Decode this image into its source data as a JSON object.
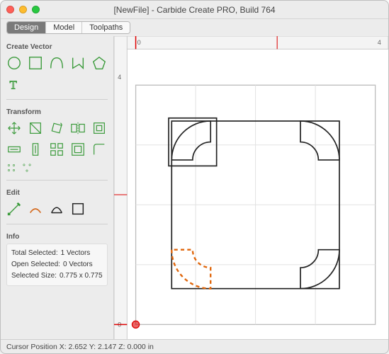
{
  "title": "[NewFile] - Carbide Create PRO, Build 764",
  "tabs": {
    "design": "Design",
    "model": "Model",
    "toolpaths": "Toolpaths",
    "active": "design"
  },
  "sections": {
    "create_vector": "Create Vector",
    "transform": "Transform",
    "edit": "Edit",
    "info": "Info"
  },
  "create_icons": [
    "circle",
    "rect",
    "curve",
    "polyline",
    "polygon",
    "text"
  ],
  "transform_icons": [
    "move",
    "resize",
    "rotate",
    "mirror",
    "align",
    "scale-width",
    "scale-height",
    "offset",
    "corner"
  ],
  "group_icons": [
    "group",
    "ungroup"
  ],
  "edit_icons": [
    "node-edit",
    "trim",
    "boolean",
    "crop"
  ],
  "info": {
    "total_selected_label": "Total Selected:",
    "total_selected_value": "1 Vectors",
    "open_selected_label": "Open Selected:",
    "open_selected_value": "0 Vectors",
    "selected_size_label": "Selected Size:",
    "selected_size_value": "0.775 x 0.775"
  },
  "ruler": {
    "top_marks": [
      "0",
      "4"
    ],
    "left_marks": [
      "0",
      "4"
    ]
  },
  "status": {
    "prefix": "Cursor Position",
    "x_label": "X:",
    "x": "2.652",
    "y_label": "Y:",
    "y": "2.147",
    "z_label": "Z:",
    "z": "0.000",
    "unit": "in"
  },
  "chart_data": {
    "type": "table",
    "title": "design canvas",
    "xlim": [
      0,
      4
    ],
    "ylim": [
      0,
      4
    ],
    "grid": true,
    "objects": [
      {
        "shape": "corner-arc",
        "pos": "top-left",
        "selected": false
      },
      {
        "shape": "corner-arc",
        "pos": "top-right",
        "selected": false
      },
      {
        "shape": "corner-arc",
        "pos": "bottom-right",
        "selected": false
      },
      {
        "shape": "corner-arc",
        "pos": "bottom-left",
        "selected": true
      },
      {
        "shape": "rect",
        "x": 0.7,
        "y": 0.7,
        "w": 0.8,
        "h": 0.8,
        "corner": "top-left"
      }
    ],
    "origin_marker": {
      "x": 0,
      "y": 0
    }
  }
}
